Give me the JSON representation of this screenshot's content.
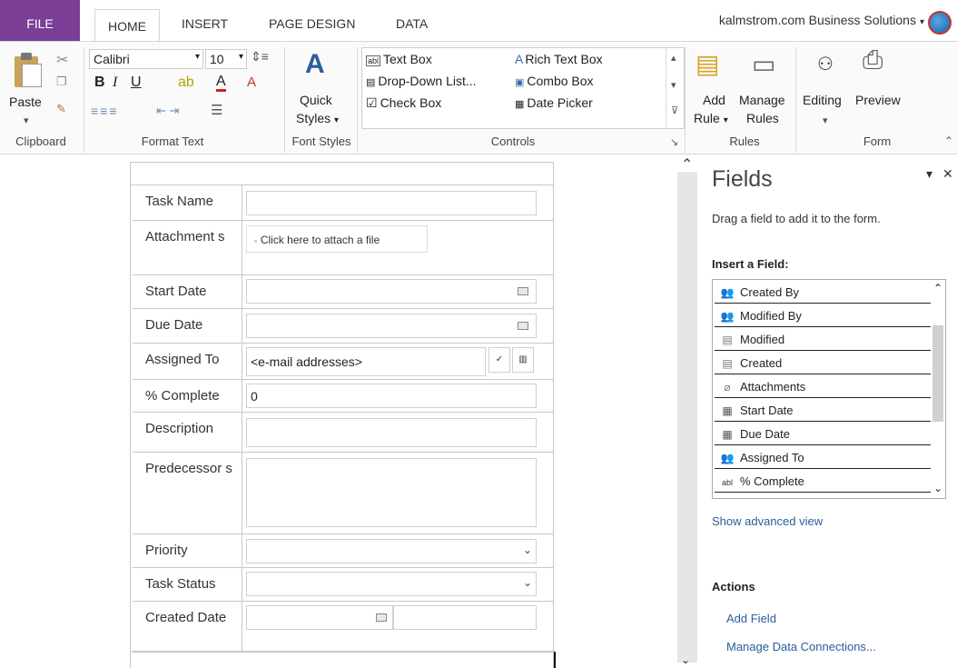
{
  "tabs": {
    "file": "FILE",
    "home": "HOME",
    "insert": "INSERT",
    "page_design": "PAGE DESIGN",
    "data": "DATA"
  },
  "account": "kalmstrom.com Business Solutions",
  "ribbon": {
    "clipboard": {
      "paste": "Paste",
      "label": "Clipboard"
    },
    "format_text": {
      "font": "Calibri",
      "size": "10",
      "bold": "B",
      "italic": "I",
      "underline": "U",
      "font_color": "A",
      "label": "Format Text"
    },
    "font_styles": {
      "quick_styles_1": "Quick",
      "quick_styles_2": "Styles",
      "label": "Font Styles"
    },
    "controls": {
      "items": [
        "Text Box",
        "Rich Text Box",
        "Drop-Down List...",
        "Combo Box",
        "Check Box",
        "Date Picker"
      ],
      "label": "Controls"
    },
    "rules": {
      "add_rule_1": "Add",
      "add_rule_2": "Rule",
      "manage_rules_1": "Manage",
      "manage_rules_2": "Rules",
      "label": "Rules"
    },
    "editing": {
      "label": "Editing"
    },
    "form": {
      "preview": "Preview",
      "label": "Form"
    }
  },
  "form": {
    "rows": [
      {
        "label": "Task Name"
      },
      {
        "label": "Attachment s",
        "attach_text": "Click here to attach a file"
      },
      {
        "label": "Start Date"
      },
      {
        "label": "Due Date"
      },
      {
        "label": "Assigned To",
        "value": "<e-mail addresses>"
      },
      {
        "label": "% Complete",
        "value": "0"
      },
      {
        "label": "Description"
      },
      {
        "label": "Predecessor s"
      },
      {
        "label": "Priority"
      },
      {
        "label": "Task Status"
      },
      {
        "label": "Created Date"
      }
    ]
  },
  "pane": {
    "title": "Fields",
    "description": "Drag a field to add it to the form.",
    "insert_heading": "Insert a Field:",
    "fields": [
      {
        "label": "Created By",
        "icon": "people-icon"
      },
      {
        "label": "Modified By",
        "icon": "people-icon"
      },
      {
        "label": "Modified",
        "icon": "date-icon"
      },
      {
        "label": "Created",
        "icon": "date-icon"
      },
      {
        "label": "Attachments",
        "icon": "paperclip-icon"
      },
      {
        "label": "Start Date",
        "icon": "calendar-icon"
      },
      {
        "label": "Due Date",
        "icon": "calendar-icon"
      },
      {
        "label": "Assigned To",
        "icon": "people-icon"
      },
      {
        "label": "% Complete",
        "icon": "textbox-icon"
      }
    ],
    "advanced_link": "Show advanced view",
    "actions_heading": "Actions",
    "actions": [
      "Add Field",
      "Manage Data Connections..."
    ]
  }
}
